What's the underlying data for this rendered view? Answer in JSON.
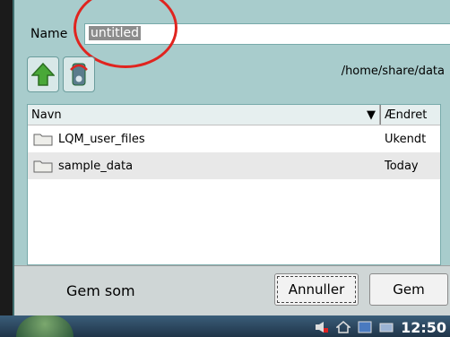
{
  "form": {
    "name_label": "Name",
    "name_value": "untitled"
  },
  "toolbar": {
    "up_icon": "up-arrow-icon",
    "device_icon": "device-icon",
    "path": "/home/share/data"
  },
  "file_list": {
    "columns": {
      "name": "Navn",
      "changed": "Ændret"
    },
    "rows": [
      {
        "name": "LQM_user_files",
        "changed": "Ukendt",
        "icon": "folder-icon"
      },
      {
        "name": "sample_data",
        "changed": "Today",
        "icon": "folder-icon"
      }
    ]
  },
  "footer": {
    "title": "Gem som",
    "cancel_label": "Annuller",
    "save_label": "Gem"
  },
  "taskbar": {
    "clock": "12:50"
  },
  "colors": {
    "dialog_bg": "#a8cccc",
    "annotation_circle": "#e0241f"
  }
}
